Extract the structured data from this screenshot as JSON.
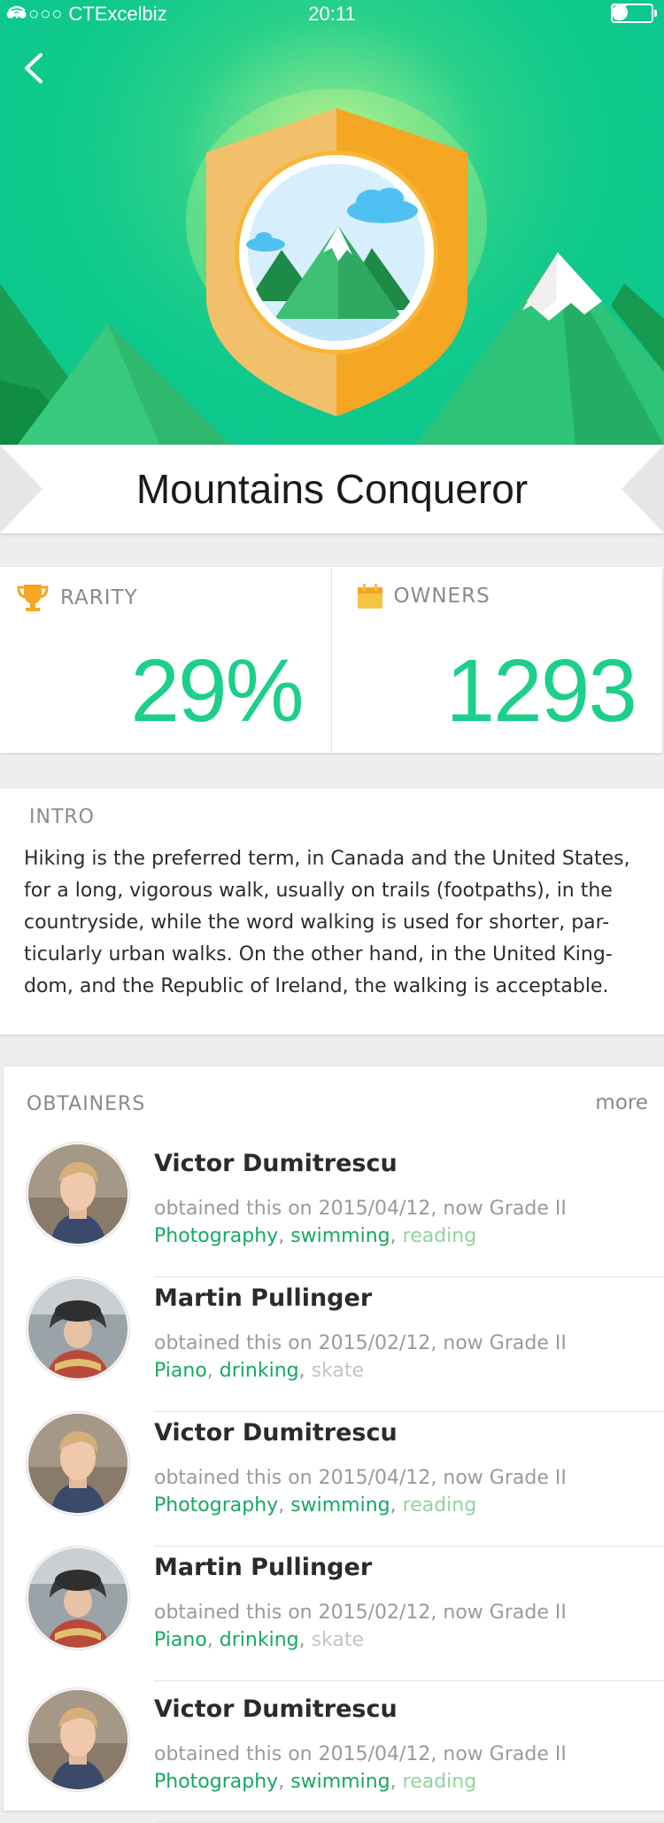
{
  "status_bar": {
    "signal": "●●○○○",
    "carrier": "CTExcelbiz",
    "time": "20:11"
  },
  "hero": {
    "back_icon": "chevron-left-icon",
    "badge_icon": "mountain-shield-badge",
    "colors": {
      "background": "#0bc98d",
      "shield_left": "#f2c06a",
      "shield_right": "#f5a623",
      "mountain_dark": "#1f9a4f",
      "mountain_light": "#36cc79"
    }
  },
  "title": "Mountains Conqueror",
  "stats": {
    "rarity": {
      "label": "RARITY",
      "value": "29%",
      "icon": "trophy-icon"
    },
    "owners": {
      "label": "OWNERS",
      "value": "1293",
      "icon": "calendar-icon"
    }
  },
  "intro": {
    "heading": "INTRO",
    "text": "Hiking is the preferred term, in Canada and the United States,\nfor a long, vigorous walk, usually on trails (footpaths), in the\ncountryside, while the word walking is used for shorter, par-\nticularly urban walks. On the other hand, in the United King-\ndom, and the Republic of Ireland, the walking is acceptable."
  },
  "obtainers": {
    "heading": "OBTAINERS",
    "more_label": "more",
    "items": [
      {
        "name": "Victor Dumitrescu",
        "meta": "obtained this on 2015/04/12, now Grade II",
        "tag1": "Photography",
        "tag2": "swimming",
        "tag3": "reading"
      },
      {
        "name": "Martin Pullinger",
        "meta": "obtained this on 2015/02/12, now Grade II",
        "tag1": "Piano",
        "tag2": "drinking",
        "tag3": "skate"
      },
      {
        "name": "Victor Dumitrescu",
        "meta": "obtained this on 2015/04/12, now Grade II",
        "tag1": "Photography",
        "tag2": "swimming",
        "tag3": "reading"
      },
      {
        "name": "Martin Pullinger",
        "meta": "obtained this on 2015/02/12, now Grade II",
        "tag1": "Piano",
        "tag2": "drinking",
        "tag3": "skate"
      },
      {
        "name": "Victor Dumitrescu",
        "meta": "obtained this on 2015/04/12, now Grade II",
        "tag1": "Photography",
        "tag2": "swimming",
        "tag3": "reading"
      }
    ],
    "colors": {
      "tag": "#16a862",
      "tag_faded_green": "#8fd59c",
      "tag_faded_grey": "#c4c4c4"
    }
  }
}
